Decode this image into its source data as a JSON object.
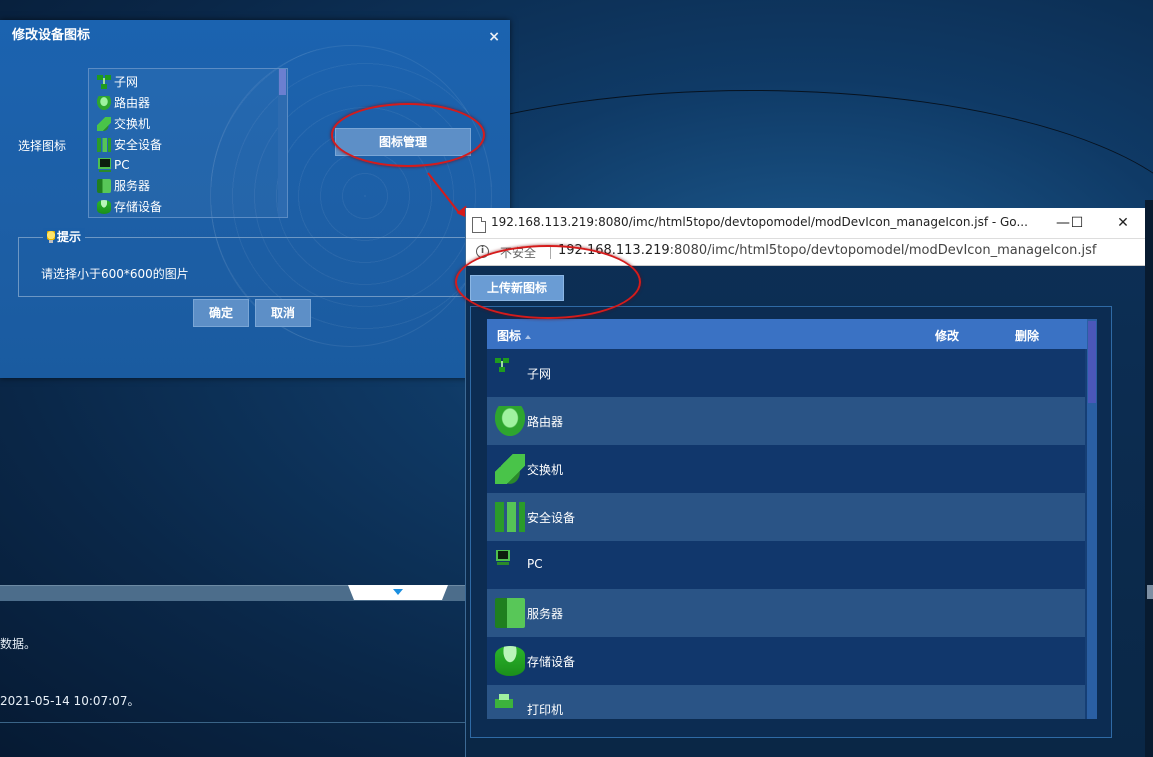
{
  "dialog": {
    "title": "修改设备图标",
    "close": "×",
    "select_label": "选择图标",
    "icon_list": [
      {
        "label": "子网",
        "icon": "subnet-icon"
      },
      {
        "label": "路由器",
        "icon": "router-icon"
      },
      {
        "label": "交换机",
        "icon": "switch-icon"
      },
      {
        "label": "安全设备",
        "icon": "security-device-icon"
      },
      {
        "label": "PC",
        "icon": "pc-icon"
      },
      {
        "label": "服务器",
        "icon": "server-icon"
      },
      {
        "label": "存储设备",
        "icon": "storage-icon"
      }
    ],
    "manage_button": "图标管理",
    "tip_title": "提示",
    "tip_text": "请选择小于600*600的图片",
    "ok": "确定",
    "cancel": "取消"
  },
  "background": {
    "text1": "数据。",
    "text2": "2021-05-14 10:07:07。"
  },
  "popup": {
    "window_title": "192.168.113.219:8080/imc/html5topo/devtopomodel/modDevIcon_manageIcon.jsf - Go...",
    "minimize": "—",
    "maximize": "☐",
    "close": "✕",
    "security_label": "不安全",
    "url_host": "192.168.113.219",
    "url_rest": ":8080/imc/html5topo/devtopomodel/modDevIcon_manageIcon.jsf",
    "upload_button": "上传新图标",
    "columns": {
      "icon": "图标",
      "edit": "修改",
      "delete": "删除"
    },
    "rows": [
      {
        "label": "子网",
        "icon": "subnet-icon"
      },
      {
        "label": "路由器",
        "icon": "router-icon"
      },
      {
        "label": "交换机",
        "icon": "switch-icon"
      },
      {
        "label": "安全设备",
        "icon": "security-device-icon"
      },
      {
        "label": "PC",
        "icon": "pc-icon"
      },
      {
        "label": "服务器",
        "icon": "server-icon"
      },
      {
        "label": "存储设备",
        "icon": "storage-icon"
      },
      {
        "label": "打印机",
        "icon": "printer-icon"
      }
    ]
  },
  "colors": {
    "annotation_red": "#d51b1b",
    "dialog_blue": "#1b63b0",
    "header_blue": "#3a72c4"
  }
}
